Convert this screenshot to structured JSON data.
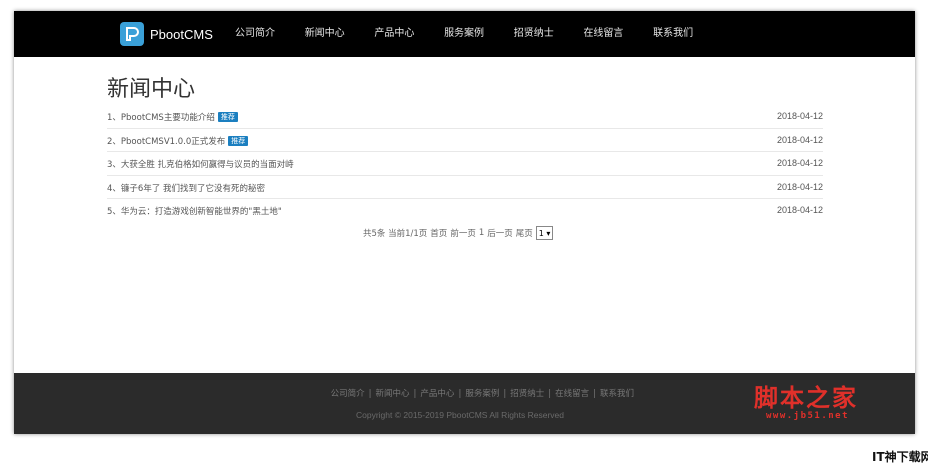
{
  "header": {
    "brand": "PbootCMS",
    "nav": [
      "公司简介",
      "新闻中心",
      "产品中心",
      "服务案例",
      "招贤纳士",
      "在线留言",
      "联系我们"
    ]
  },
  "main": {
    "title": "新闻中心",
    "news": [
      {
        "title": "1、PbootCMS主要功能介绍",
        "badge": "推荐",
        "date": "2018-04-12"
      },
      {
        "title": "2、PbootCMSV1.0.0正式发布",
        "badge": "推荐",
        "date": "2018-04-12"
      },
      {
        "title": "3、大获全胜 扎克伯格如何赢得与议员的当面对峙",
        "badge": "",
        "date": "2018-04-12"
      },
      {
        "title": "4、镰子6年了 我们找到了它没有死的秘密",
        "badge": "",
        "date": "2018-04-12"
      },
      {
        "title": "5、华为云：打造游戏创新智能世界的\"黑土地\"",
        "badge": "",
        "date": "2018-04-12"
      }
    ],
    "pager": {
      "summary": "共5条 当前1/1页",
      "first": "首页",
      "prev": "前一页",
      "current": "1",
      "next": "后一页",
      "last": "尾页",
      "select_value": "1 ▾"
    }
  },
  "footer": {
    "links": [
      "公司简介",
      "新闻中心",
      "产品中心",
      "服务案例",
      "招贤纳士",
      "在线留言",
      "联系我们"
    ],
    "copyright": "Copyright © 2015-2019 PbootCMS All Rights Reserved"
  },
  "watermark": {
    "logo": "脚本之家",
    "url": "www.jb51.net",
    "corner": "IT神下载网"
  },
  "colors": {
    "header_bg": "#000000",
    "footer_bg": "#2b2b2b",
    "badge": "#1b7fc0",
    "logo_blue": "#3aa0d8",
    "watermark_red": "#e0302a"
  }
}
